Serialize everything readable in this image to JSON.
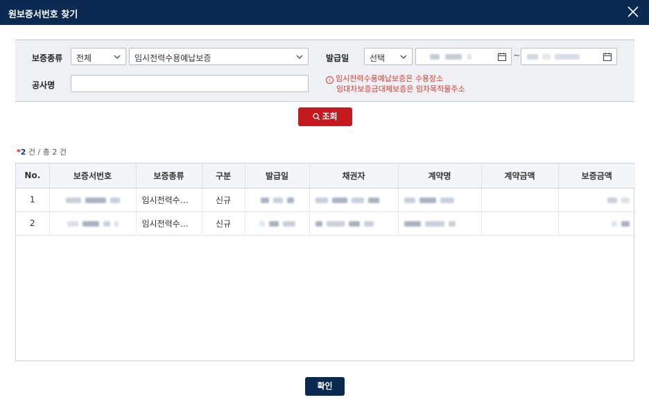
{
  "dialog": {
    "title": "원보증서번호 찾기"
  },
  "search": {
    "guarantee_type_label": "보증종류",
    "guarantee_type_filter": "전체",
    "guarantee_type_value": "임시전력수용예납보증",
    "issue_date_label": "발급일",
    "issue_date_mode": "선택",
    "date_separator": "~",
    "project_name_label": "공사명",
    "project_name_value": "",
    "notice_line1": "임시전력수용예납보증은 수용장소",
    "notice_line2": "임대차보증금대체보증은 임차목적물주소",
    "search_button": "조회"
  },
  "results": {
    "count_prefix": "*",
    "count_num": "2",
    "count_text": " 건 / 총 2 건",
    "columns": [
      "No.",
      "보증서번호",
      "보증종류",
      "구분",
      "발급일",
      "채권자",
      "계약명",
      "계약금액",
      "보증금액"
    ],
    "rows": [
      {
        "no": "1",
        "type": "임시전력수용…",
        "category": "신규"
      },
      {
        "no": "2",
        "type": "임시전력수용…",
        "category": "신규"
      }
    ]
  },
  "footer": {
    "confirm_button": "확인"
  },
  "colors": {
    "header_bg": "#0b2a52",
    "search_button": "#c4191f",
    "notice_text": "#d83b2f"
  }
}
